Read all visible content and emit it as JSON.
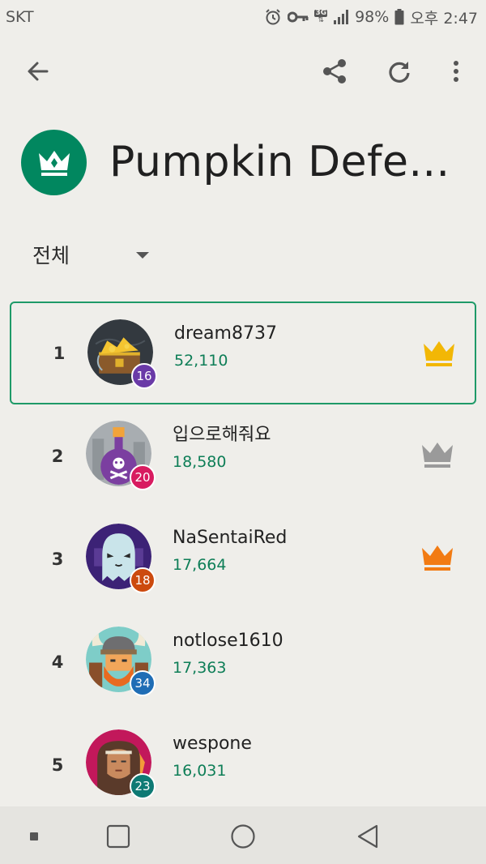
{
  "status_bar": {
    "carrier": "SKT",
    "network_type": "3G",
    "battery": "98%",
    "time": "오후 2:47",
    "icons": [
      "alarm-icon",
      "key-icon",
      "network-3g-icon",
      "signal-icon",
      "battery-icon"
    ]
  },
  "app_bar": {
    "icons": [
      "back-arrow-icon",
      "share-icon",
      "refresh-icon",
      "more-vert-icon"
    ]
  },
  "header": {
    "title": "Pumpkin Defe...",
    "badge_icon": "crown-icon",
    "badge_color": "#01875f"
  },
  "filter": {
    "selected": "전체",
    "icon": "dropdown-caret-icon"
  },
  "leaderboard": [
    {
      "rank": "1",
      "name": "dream8737",
      "score": "52,110",
      "level": "16",
      "level_color": "#6a3aa7",
      "crown": "gold",
      "avatar": "treasure-chest-avatar",
      "highlighted": true
    },
    {
      "rank": "2",
      "name": "입으로해줘요",
      "score": "18,580",
      "level": "20",
      "level_color": "#d81b60",
      "crown": "silver",
      "avatar": "poison-bottle-avatar",
      "highlighted": false
    },
    {
      "rank": "3",
      "name": "NaSentaiRed",
      "score": "17,664",
      "level": "18",
      "level_color": "#cc4a0e",
      "crown": "bronze",
      "avatar": "ghost-avatar",
      "highlighted": false
    },
    {
      "rank": "4",
      "name": "notlose1610",
      "score": "17,363",
      "level": "34",
      "level_color": "#1f6db5",
      "crown": "",
      "avatar": "viking-avatar",
      "highlighted": false
    },
    {
      "rank": "5",
      "name": "wespone",
      "score": "16,031",
      "level": "23",
      "level_color": "#0e7a74",
      "crown": "",
      "avatar": "warrior-avatar",
      "highlighted": false
    }
  ],
  "crown_colors": {
    "gold": "#f2b705",
    "silver": "#9a9a9a",
    "bronze": "#f27b13"
  },
  "nav_bar": {
    "icons": [
      "recents-dot-icon",
      "overview-square-icon",
      "home-circle-icon",
      "back-triangle-icon"
    ]
  }
}
